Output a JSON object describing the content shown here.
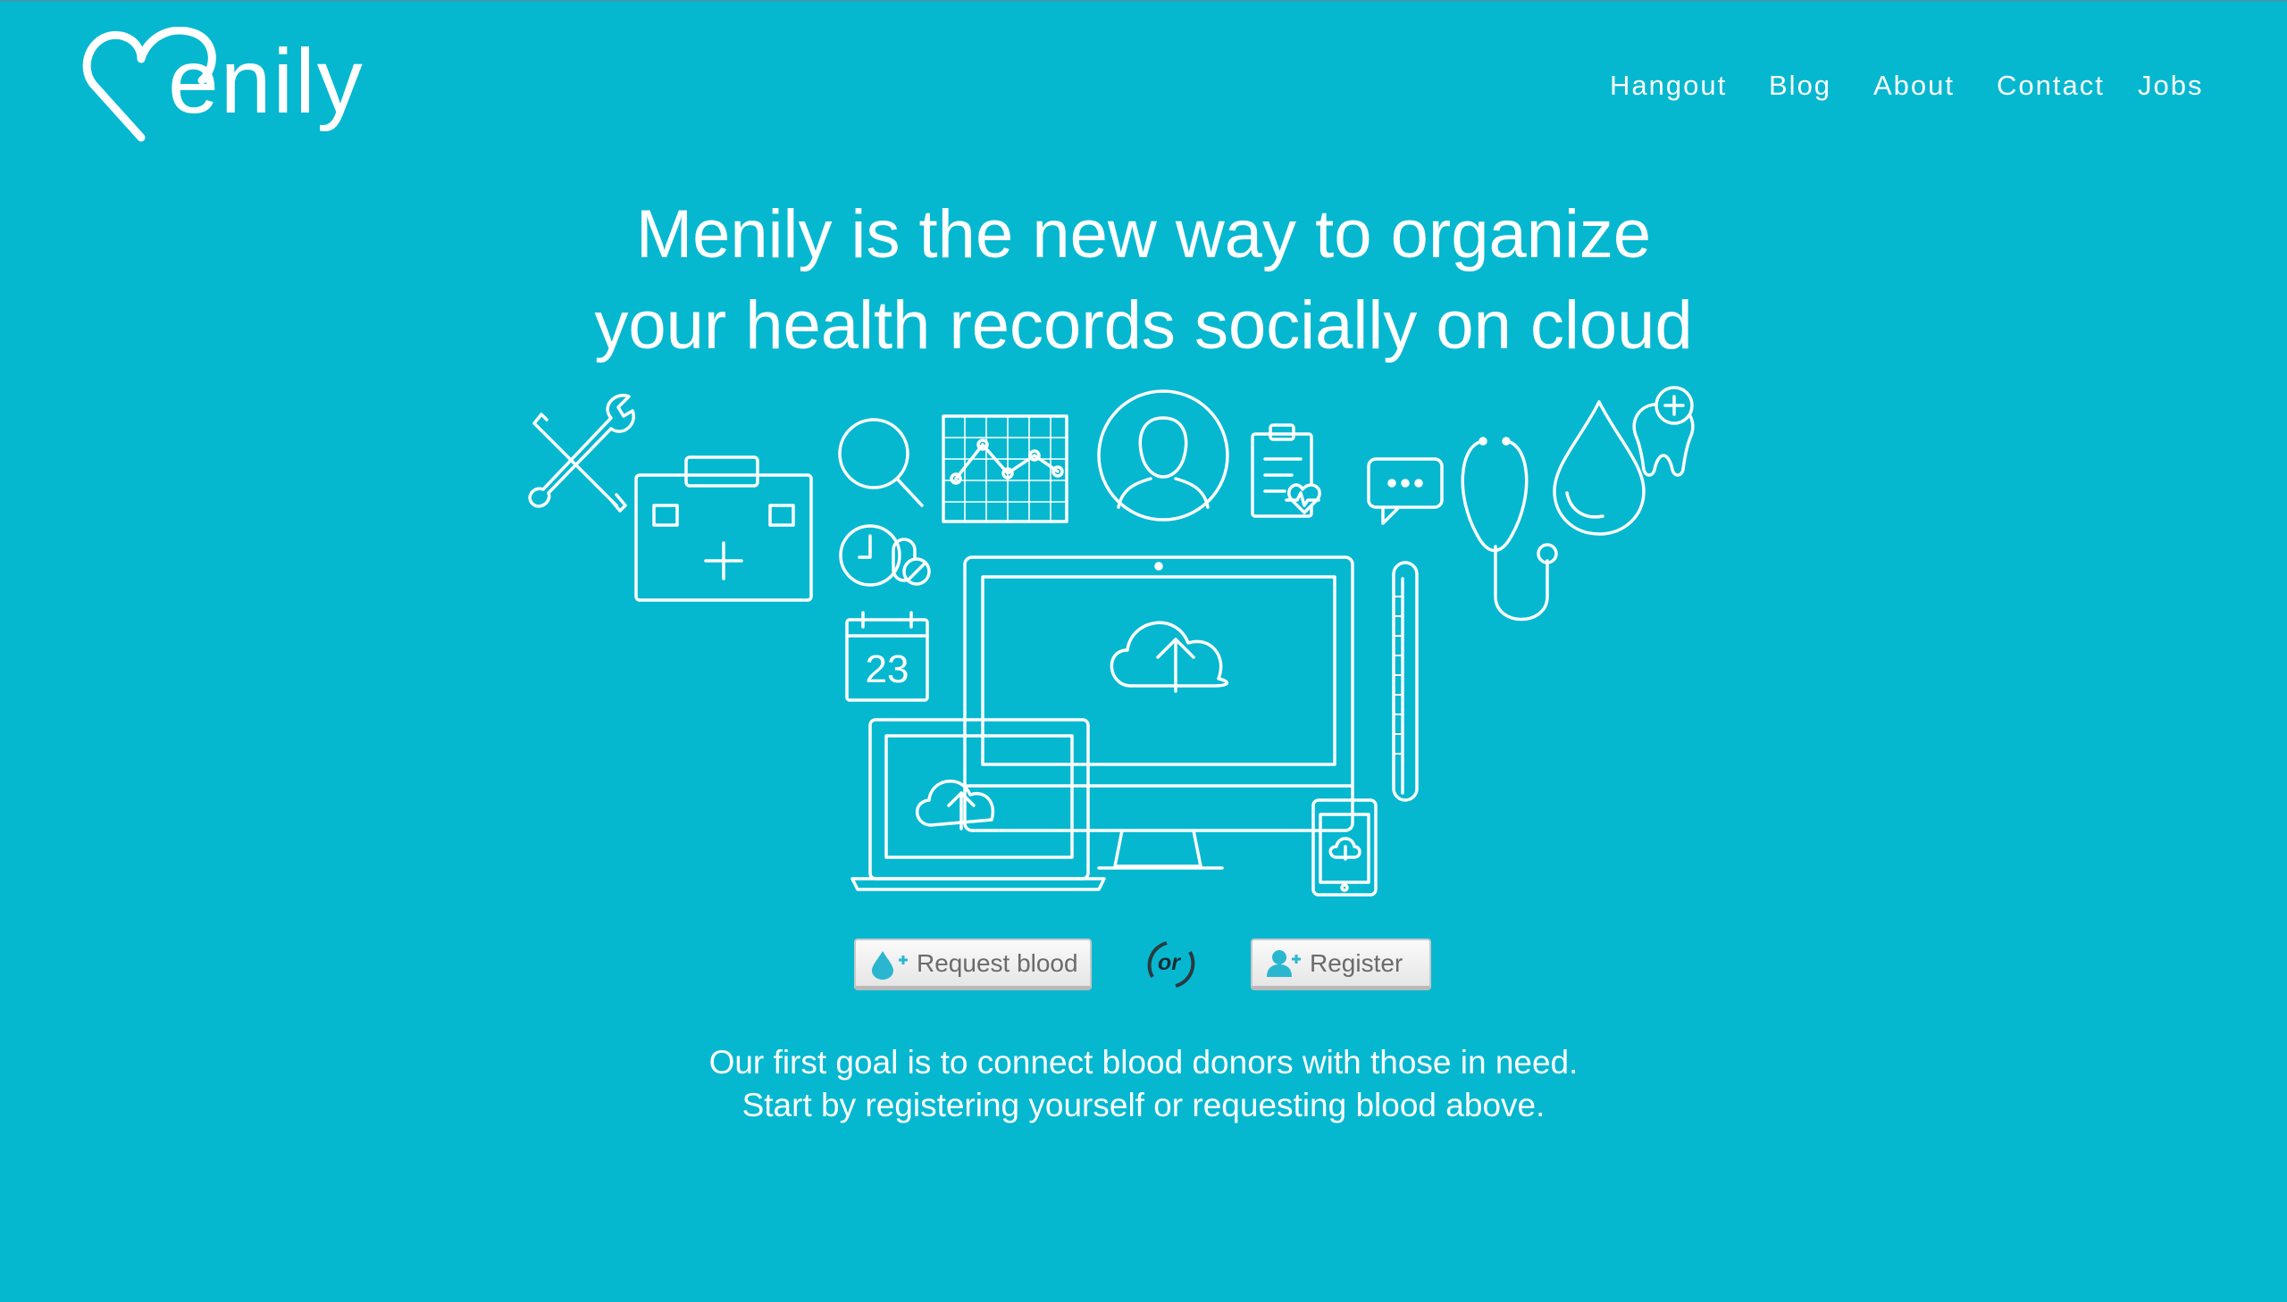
{
  "brand": {
    "logo_text": "enily"
  },
  "nav": {
    "hangout": "Hangout",
    "blog": "Blog",
    "about": "About",
    "contact": "Contact",
    "jobs": "Jobs"
  },
  "hero": {
    "line1": "Menily is the new way to organize",
    "line2": "your health records socially on cloud"
  },
  "illustration": {
    "calendar_day": "23"
  },
  "actions": {
    "request_label": "Request blood",
    "or_label": "or",
    "register_label": "Register"
  },
  "tagline": {
    "line1": "Our first goal is to connect blood donors with those in need.",
    "line2": "Start by registering yourself or requesting blood above."
  },
  "colors": {
    "background": "#05b8d0",
    "accent": "#2ab6cf"
  },
  "icons": [
    "heart-logo-icon",
    "tools-icon",
    "medical-kit-icon",
    "magnifier-icon",
    "chart-icon",
    "user-icon",
    "clipboard-icon",
    "chat-icon",
    "stethoscope-icon",
    "blood-drop-icon",
    "tooth-icon",
    "clock-pills-icon",
    "calendar-icon",
    "monitor-icon",
    "laptop-icon",
    "tablet-icon",
    "thermometer-icon",
    "cloud-upload-icon"
  ]
}
